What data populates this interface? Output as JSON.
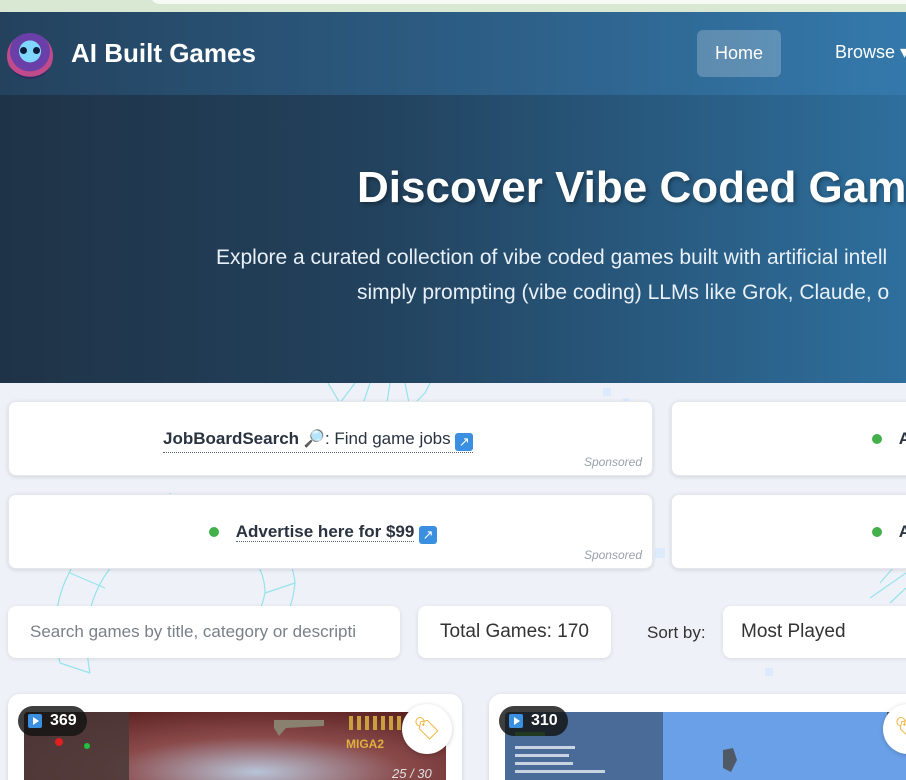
{
  "nav": {
    "brand": "AI Built Games",
    "home": "Home",
    "browse": "Browse ▾"
  },
  "hero": {
    "title": "Discover Vibe Coded Gam",
    "subtitle_line1": "Explore a curated collection of vibe coded games built with artificial intell",
    "subtitle_line2": "simply prompting (vibe coding) LLMs like Grok, Claude, o"
  },
  "ads": [
    {
      "name": "JobBoardSearch",
      "emoji": "🔎",
      "text": ": Find game jobs",
      "ext": "↗",
      "sponsored": "Sponsored"
    },
    {
      "lead": "A"
    },
    {
      "text": "Advertise here for $99",
      "ext": "↗",
      "sponsored": "Sponsored"
    },
    {
      "lead": "A"
    }
  ],
  "controls": {
    "search_placeholder": "Search games by title, category or descripti",
    "total_games": "Total Games: 170",
    "sort_label": "Sort by:",
    "sort_value": "Most Played"
  },
  "games": [
    {
      "plays": "369",
      "hud_label": "MIGA2",
      "hud_count": "25 / 30"
    },
    {
      "plays": "310"
    }
  ],
  "colors": {
    "accent": "#3a8fe0",
    "status_dot": "#43b04a",
    "tag": "#f0b030"
  }
}
